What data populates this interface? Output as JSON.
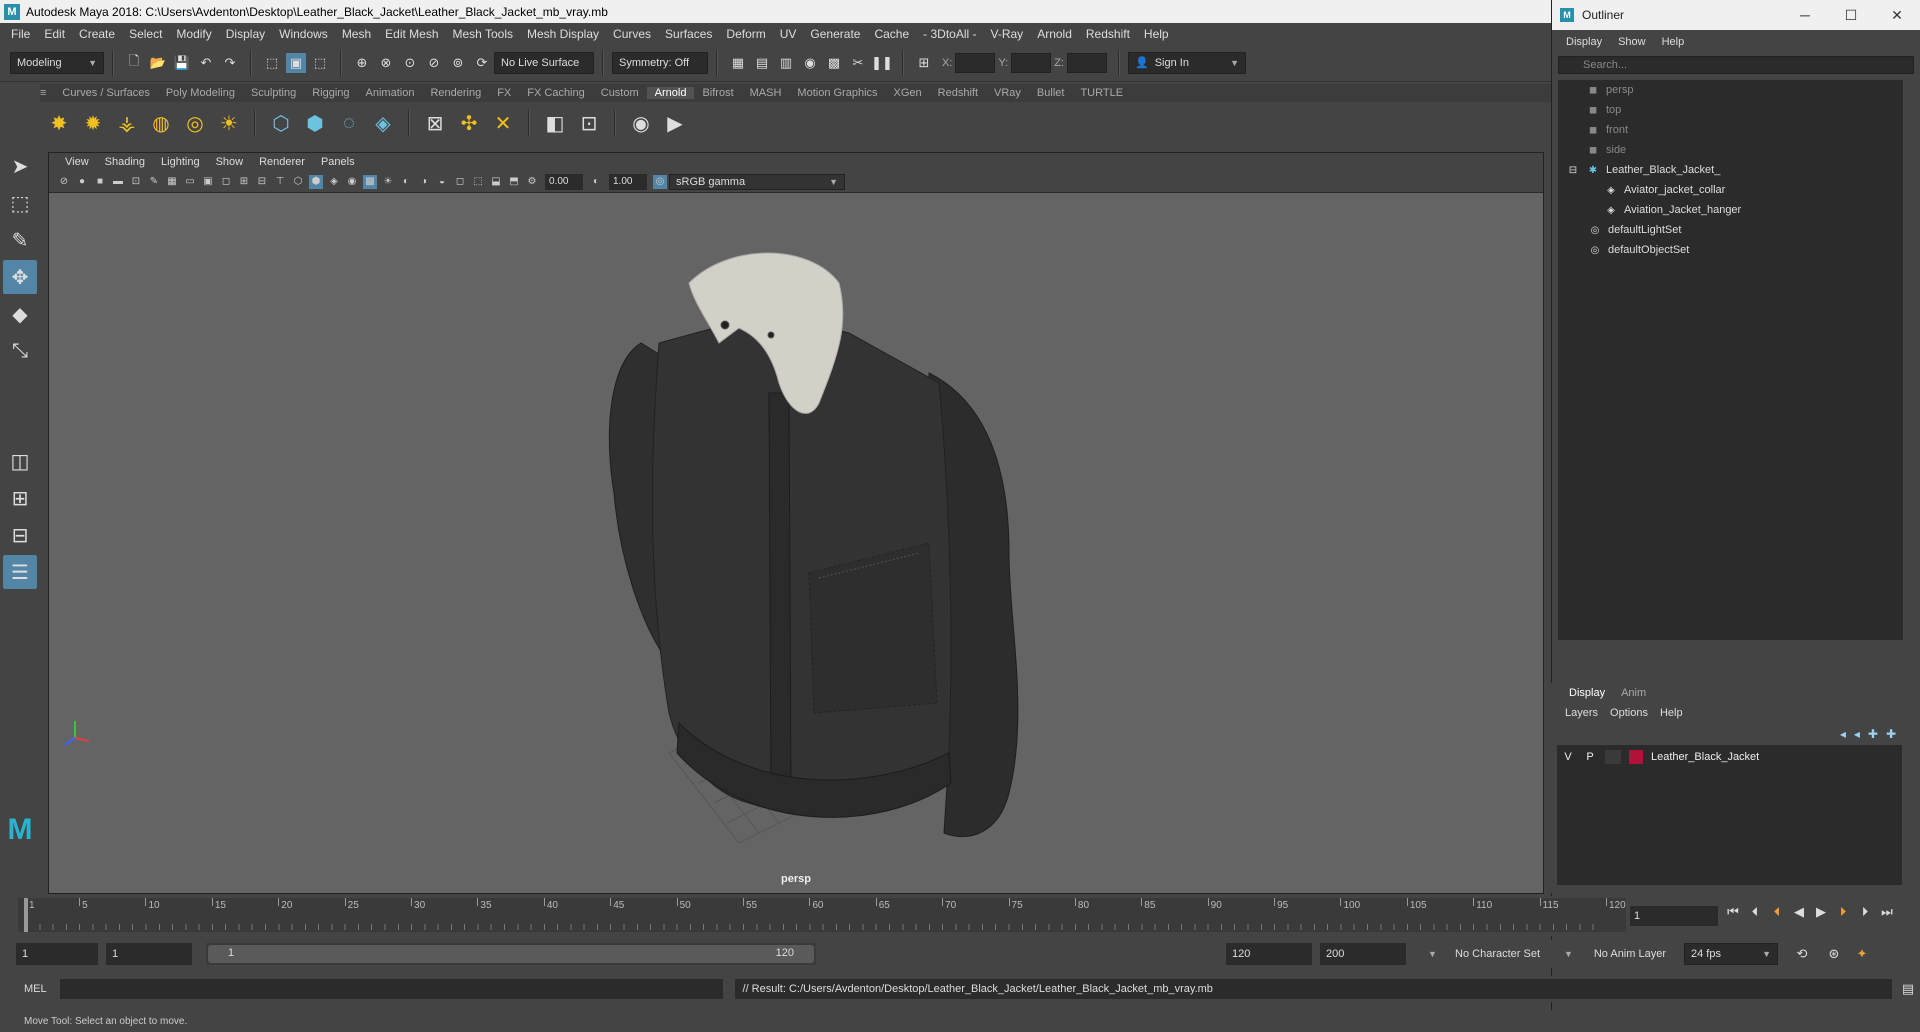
{
  "window": {
    "title": "Autodesk Maya 2018: C:\\Users\\Avdenton\\Desktop\\Leather_Black_Jacket\\Leather_Black_Jacket_mb_vray.mb"
  },
  "menubar": [
    "File",
    "Edit",
    "Create",
    "Select",
    "Modify",
    "Display",
    "Windows",
    "Mesh",
    "Edit Mesh",
    "Mesh Tools",
    "Mesh Display",
    "Curves",
    "Surfaces",
    "Deform",
    "UV",
    "Generate",
    "Cache",
    "- 3DtoAll -",
    "V-Ray",
    "Arnold",
    "Redshift",
    "Help"
  ],
  "statusline": {
    "mode": "Modeling",
    "live_surface": "No Live Surface",
    "symmetry": "Symmetry: Off",
    "x_label": "X:",
    "y_label": "Y:",
    "z_label": "Z:",
    "sign_in": "Sign In"
  },
  "shelf_tabs": [
    "Curves / Surfaces",
    "Poly Modeling",
    "Sculpting",
    "Rigging",
    "Animation",
    "Rendering",
    "FX",
    "FX Caching",
    "Custom",
    "Arnold",
    "Bifrost",
    "MASH",
    "Motion Graphics",
    "XGen",
    "Redshift",
    "VRay",
    "Bullet",
    "TURTLE"
  ],
  "shelf_active": "Arnold",
  "viewport": {
    "menu": [
      "View",
      "Shading",
      "Lighting",
      "Show",
      "Renderer",
      "Panels"
    ],
    "exposure": "0.00",
    "gamma": "1.00",
    "color_space": "sRGB gamma",
    "camera": "persp"
  },
  "outliner": {
    "title": "Outliner",
    "menu": [
      "Display",
      "Show",
      "Help"
    ],
    "search_placeholder": "Search...",
    "items": [
      {
        "label": "persp",
        "dim": true
      },
      {
        "label": "top",
        "dim": true
      },
      {
        "label": "front",
        "dim": true
      },
      {
        "label": "side",
        "dim": true
      },
      {
        "label": "Leather_Black_Jacket_",
        "dim": false
      },
      {
        "label": "Aviator_jacket_collar",
        "dim": false
      },
      {
        "label": "Aviation_Jacket_hanger",
        "dim": false
      },
      {
        "label": "defaultLightSet",
        "dim": false
      },
      {
        "label": "defaultObjectSet",
        "dim": false
      }
    ]
  },
  "layer_editor": {
    "tabs": [
      "Display",
      "Anim"
    ],
    "menu": [
      "Layers",
      "Options",
      "Help"
    ],
    "layer": {
      "v": "V",
      "p": "P",
      "name": "Leather_Black_Jacket",
      "color": "#b0123a"
    }
  },
  "timeline": {
    "ticks": [
      "1",
      "5",
      "10",
      "15",
      "20",
      "25",
      "30",
      "35",
      "40",
      "45",
      "50",
      "55",
      "60",
      "65",
      "70",
      "75",
      "80",
      "85",
      "90",
      "95",
      "100",
      "105",
      "110",
      "115",
      "120"
    ],
    "current_frame": "1"
  },
  "range": {
    "start": "1",
    "playback_start": "1",
    "slider_start": "1",
    "slider_end": "120",
    "playback_end": "120",
    "end": "200",
    "character_set": "No Character Set",
    "anim_layer": "No Anim Layer",
    "fps": "24 fps"
  },
  "command": {
    "lang": "MEL",
    "result": "// Result: C:/Users/Avdenton/Desktop/Leather_Black_Jacket/Leather_Black_Jacket_mb_vray.mb"
  },
  "helpline": "Move Tool: Select an object to move."
}
